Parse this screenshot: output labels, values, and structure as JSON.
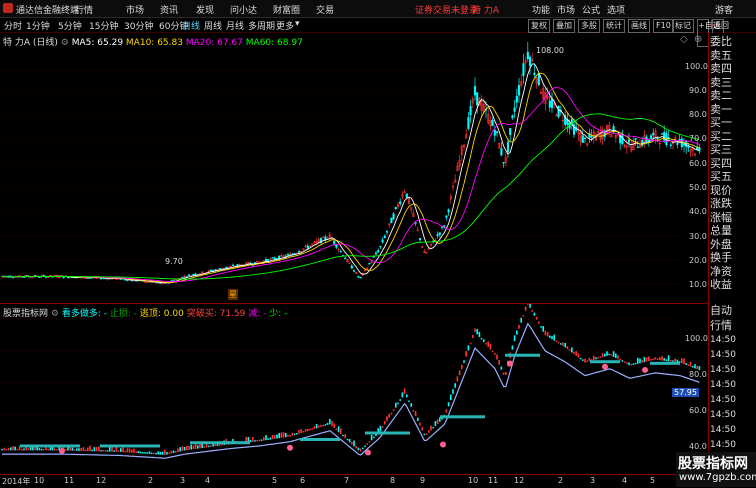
{
  "app": {
    "title": "通达信金融终端"
  },
  "menu": [
    "行情",
    "市场",
    "资讯",
    "发现",
    "问小达",
    "财富圈",
    "交易"
  ],
  "account_status": "证券交易未登录",
  "stock_short": "特 力A",
  "top_right": [
    "功能",
    "市场",
    "公式",
    "选项"
  ],
  "guest_label": "游客",
  "periods": [
    "分时",
    "1分钟",
    "5分钟",
    "15分钟",
    "30分钟",
    "60分钟",
    "日线",
    "周线",
    "月线",
    "多周期",
    "更多"
  ],
  "active_period": "日线",
  "toolbar": [
    "复权",
    "叠加",
    "多股",
    "统计",
    "画线",
    "F10",
    "标记",
    "+自选",
    "返回"
  ],
  "ma_bar": {
    "stock": "特 力A (日线)",
    "items": [
      {
        "label": "MA5: 65.29",
        "color": "#ffffff"
      },
      {
        "label": "MA10: 65.83",
        "color": "#ffd700"
      },
      {
        "label": "MA20: 67.67",
        "color": "#ff00ff"
      },
      {
        "label": "MA60: 68.97",
        "color": "#00ff00"
      }
    ]
  },
  "peak_label": "108.00",
  "low_label": "9.70",
  "event_marker": "星",
  "main_y_ticks": [
    "100.0",
    "90.0",
    "80.0",
    "70.0",
    "60.0",
    "50.0",
    "40.0",
    "30.0",
    "20.0",
    "10.0"
  ],
  "indicator": {
    "name": "股票指标网",
    "items": [
      {
        "label": "看多做多: -",
        "color": "#00ffff"
      },
      {
        "label": "止损: -",
        "color": "#00aa00"
      },
      {
        "label": "逃顶: 0.00",
        "color": "#ffd700"
      },
      {
        "label": "突破买: 71.59",
        "color": "#ff4040"
      },
      {
        "label": "减: -",
        "color": "#ff00ff"
      },
      {
        "label": "少: -",
        "color": "#00ff00"
      }
    ]
  },
  "sub_y_ticks": [
    "100.0",
    "80.0",
    "60.0",
    "40.0"
  ],
  "sub_value_tag": "57.95",
  "x_labels": [
    "2014年",
    "10",
    "11",
    "12",
    "2",
    "3",
    "4",
    "5",
    "6",
    "7",
    "8",
    "9",
    "10",
    "11",
    "12",
    "2",
    "3",
    "4",
    "5"
  ],
  "right_panel": [
    "委比",
    "卖五",
    "卖四",
    "卖三",
    "卖二",
    "卖一",
    "买一",
    "买二",
    "买三",
    "买四",
    "买五",
    "现价",
    "涨跌",
    "涨幅",
    "总量",
    "外盘",
    "换手",
    "净资",
    "收益"
  ],
  "right_panel_bottom": [
    "自动",
    "行情",
    "14:50",
    "14:50",
    "14:50",
    "14:50",
    "14:50",
    "14:50",
    "14:50",
    "14:50",
    "14:50"
  ],
  "watermark": {
    "line1": "股票指标网",
    "line2": "www.7gpzb.com"
  },
  "colors": {
    "up": "#ff3232",
    "down": "#00ffff",
    "ma5": "#ffffff",
    "ma10": "#ffd700",
    "ma20": "#ff00ff",
    "ma60": "#00ff00"
  }
}
